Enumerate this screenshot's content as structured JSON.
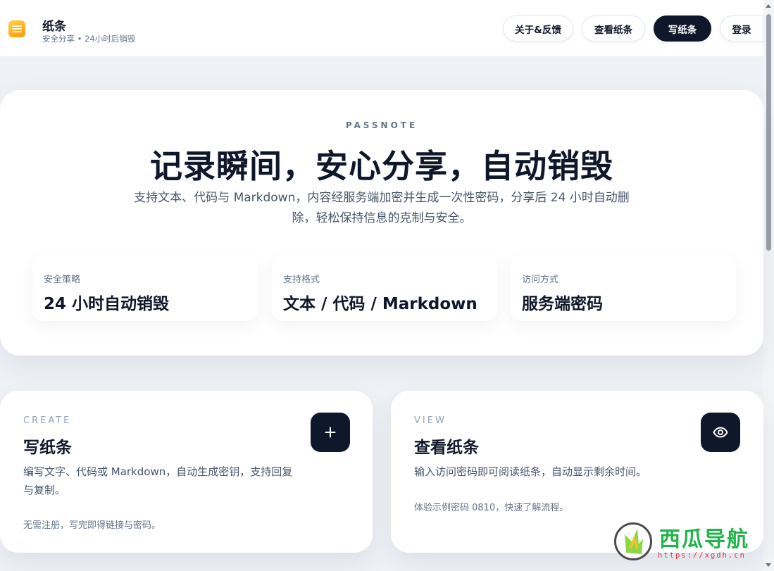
{
  "brand": {
    "title": "纸条",
    "subtitle": "安全分享 • 24小时后销毁"
  },
  "nav": {
    "about": "关于&反馈",
    "view": "查看纸条",
    "write": "写纸条",
    "login": "登录"
  },
  "hero": {
    "eyebrow": "PASSNOTE",
    "title": "记录瞬间，安心分享，自动销毁",
    "description_line1": "支持文本、代码与 Markdown，内容经服务端加密并生成一次性密码，分享后 24 小时自动删",
    "description_line2": "除，轻松保持信息的克制与安全。",
    "stats": [
      {
        "label": "安全策略",
        "value": "24 小时自动销毁"
      },
      {
        "label": "支持格式",
        "value": "文本 / 代码 / Markdown"
      },
      {
        "label": "访问方式",
        "value": "服务端密码"
      }
    ]
  },
  "cards": {
    "create": {
      "eyebrow": "CREATE",
      "title": "写纸条",
      "description": "编写文字、代码或 Markdown，自动生成密钥，支持回复与复制。",
      "note": "无需注册，写完即得链接与密码。",
      "icon": "plus-icon"
    },
    "view": {
      "eyebrow": "VIEW",
      "title": "查看纸条",
      "description": "输入访问密码即可阅读纸条，自动显示剩余时间。",
      "note": "体验示例密码 0810，快速了解流程。",
      "icon": "eye-icon"
    }
  },
  "watermark": {
    "text": "西瓜导航",
    "url": "https://xgdh.cn"
  },
  "colors": {
    "primary": "#0f172a",
    "brand_icon": "#ffb020",
    "background": "#eef1f6",
    "muted": "#64748b"
  }
}
